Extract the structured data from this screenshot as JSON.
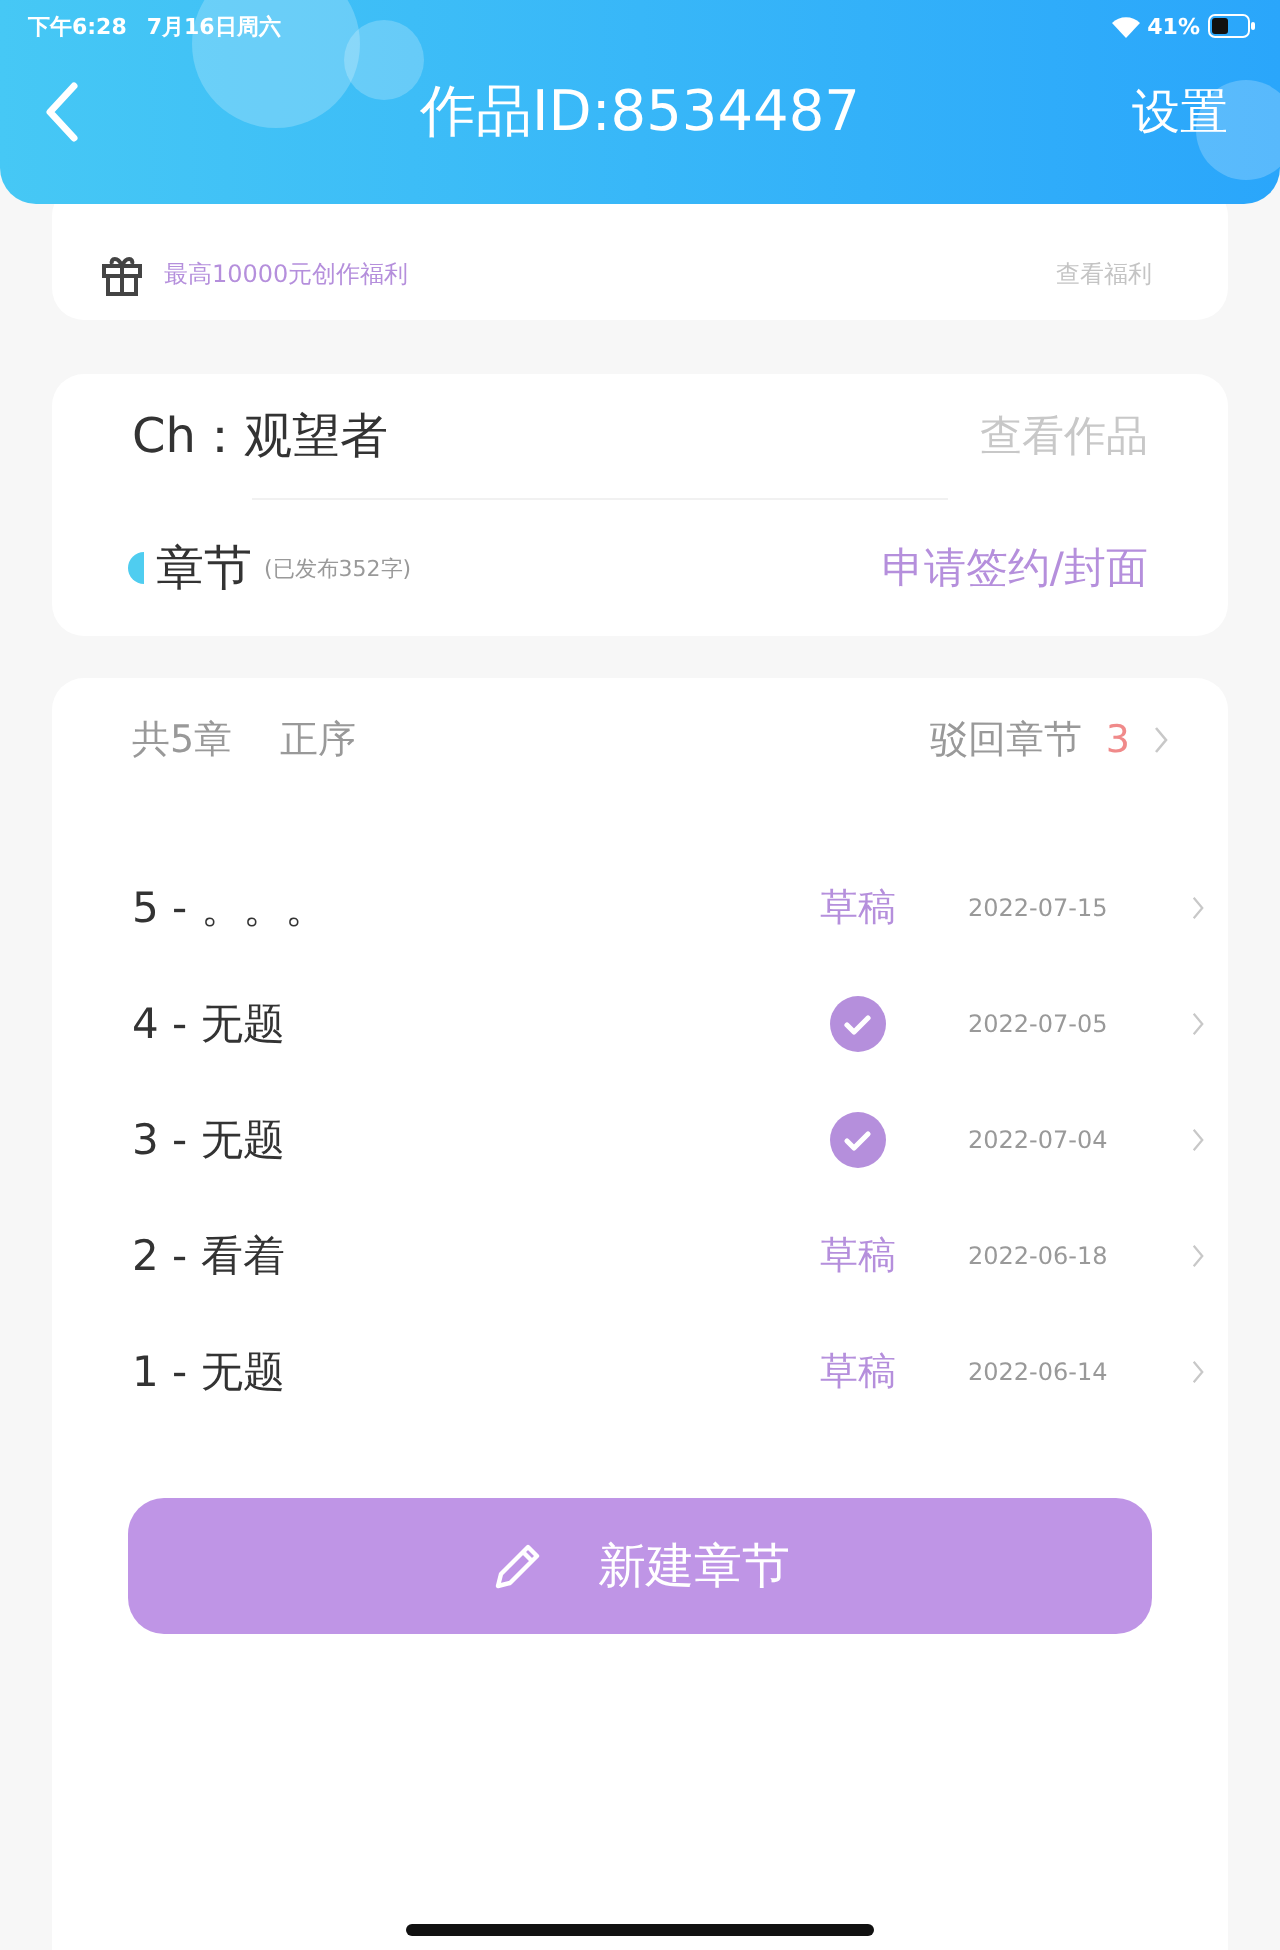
{
  "status_bar": {
    "time": "下午6:28",
    "date": "7月16日周六",
    "battery": "41%"
  },
  "header": {
    "title": "作品ID:8534487",
    "action": "设置"
  },
  "benefit": {
    "text": "最高10000元创作福利",
    "link": "查看福利"
  },
  "work": {
    "name": "Ch：观望者",
    "link": "查看作品",
    "section": "章节",
    "published": "(已发布352字)",
    "apply": "申请签约/封面"
  },
  "chapters_bar": {
    "count": "共5章",
    "order": "正序",
    "rejected_label": "驳回章节",
    "rejected_count": "3"
  },
  "chapters": [
    {
      "title": "5 - 。。。",
      "kind": "draft",
      "status": "草稿",
      "date": "2022-07-15"
    },
    {
      "title": "4 - 无题",
      "kind": "published",
      "date": "2022-07-05"
    },
    {
      "title": "3 - 无题",
      "kind": "published",
      "date": "2022-07-04"
    },
    {
      "title": "2 - 看着",
      "kind": "draft",
      "status": "草稿",
      "date": "2022-06-18"
    },
    {
      "title": "1 - 无题",
      "kind": "draft",
      "status": "草稿",
      "date": "2022-06-14"
    }
  ],
  "new_button": "新建章节"
}
